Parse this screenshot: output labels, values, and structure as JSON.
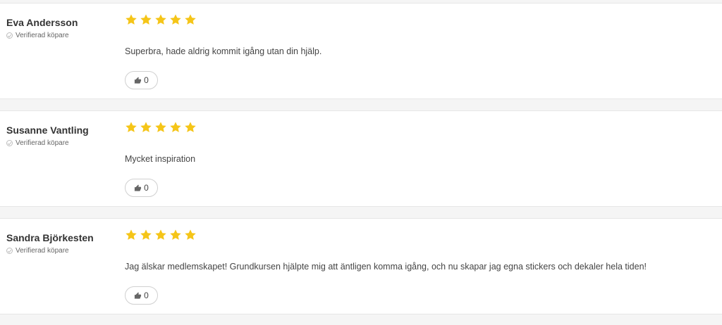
{
  "reviews": [
    {
      "author": "Eva Andersson",
      "verified_label": "Verifierad köpare",
      "rating": 5,
      "text": "Superbra, hade aldrig kommit igång utan din hjälp.",
      "helpful_count": "0"
    },
    {
      "author": "Susanne Vantling",
      "verified_label": "Verifierad köpare",
      "rating": 5,
      "text": "Mycket inspiration",
      "helpful_count": "0"
    },
    {
      "author": "Sandra Björkesten",
      "verified_label": "Verifierad köpare",
      "rating": 5,
      "text": "Jag älskar medlemskapet! Grundkursen hjälpte mig att äntligen komma igång, och nu skapar jag egna stickers och dekaler hela tiden!",
      "helpful_count": "0"
    }
  ],
  "icons": {
    "star": "star-icon",
    "verified": "check-circle-icon",
    "helpful": "thumbs-up-icon"
  },
  "colors": {
    "star": "#f5c518",
    "background": "#f5f5f5",
    "card": "#ffffff"
  }
}
